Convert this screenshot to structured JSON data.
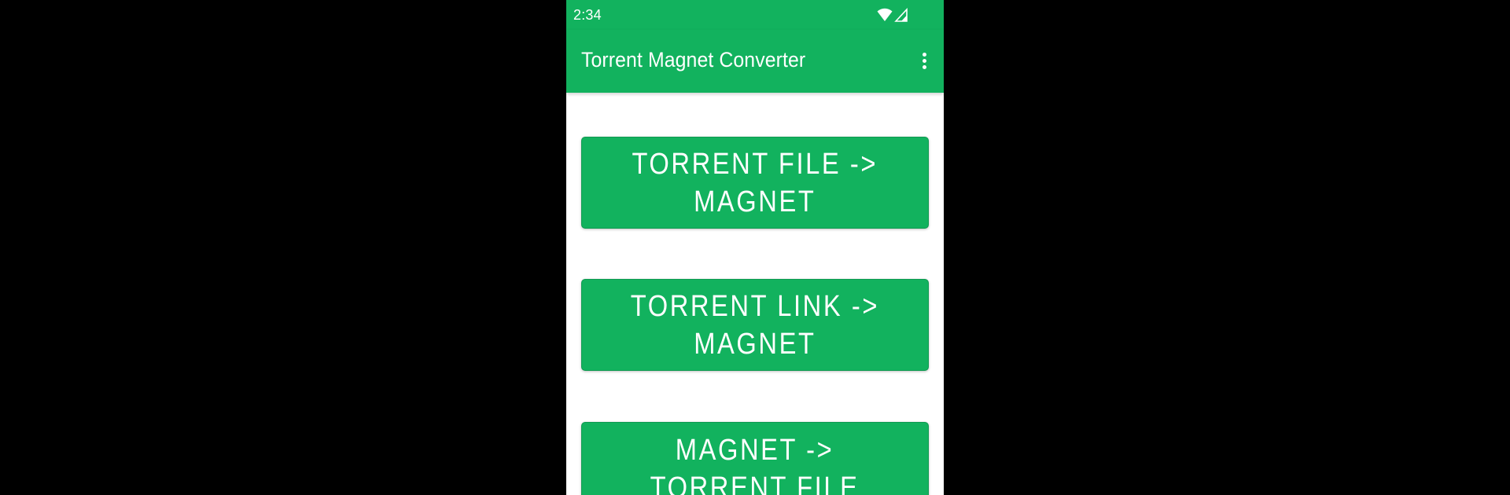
{
  "status_bar": {
    "time": "2:34",
    "icons": [
      "wifi-icon",
      "cellular-signal-icon"
    ]
  },
  "app_bar": {
    "title": "Torrent Magnet Converter",
    "overflow_icon": "more-vert-icon"
  },
  "buttons": [
    {
      "label_line1": "TORRENT FILE ->",
      "label_line2": "MAGNET"
    },
    {
      "label_line1": "TORRENT LINK ->",
      "label_line2": "MAGNET"
    },
    {
      "label_line1": "MAGNET ->",
      "label_line2": "TORRENT FILE"
    }
  ],
  "colors": {
    "primary": "#12b25e",
    "background": "#ffffff",
    "outer_background": "#000000",
    "text_on_primary": "#ffffff"
  }
}
